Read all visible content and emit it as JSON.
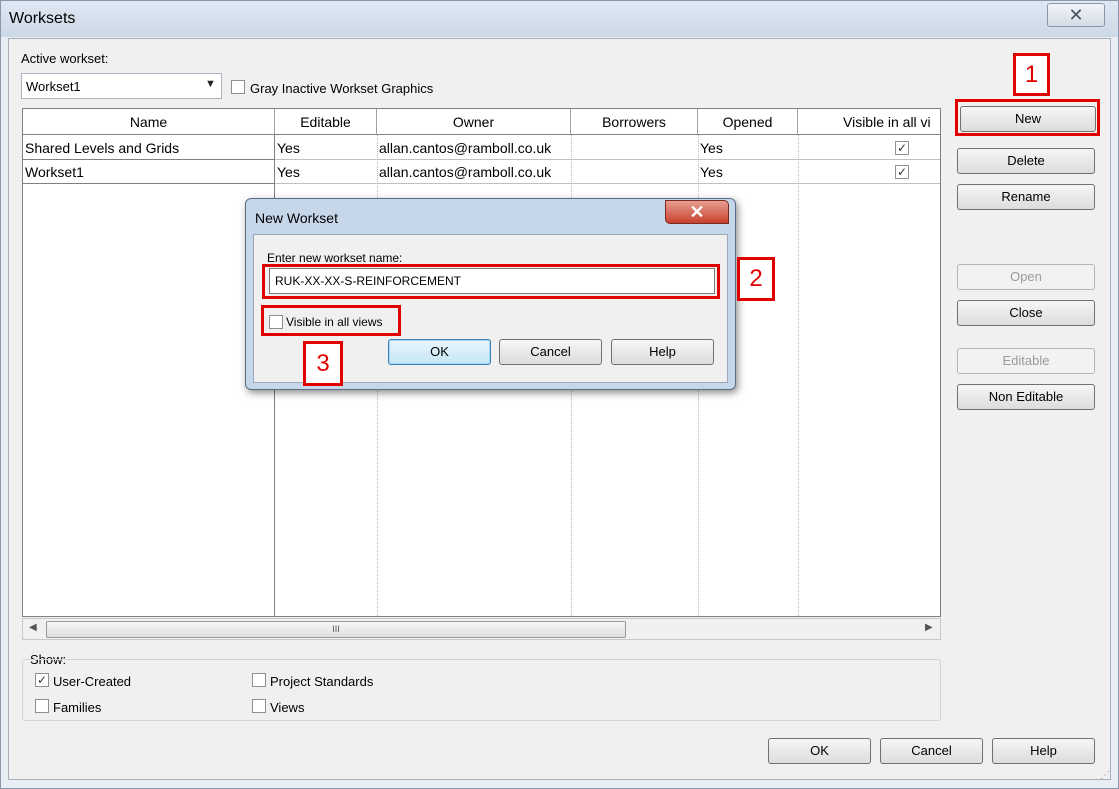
{
  "window": {
    "title": "Worksets",
    "close_glyph": "✕"
  },
  "active_workset": {
    "label": "Active workset:",
    "value": "Workset1"
  },
  "gray_inactive": {
    "label": "Gray Inactive Workset Graphics",
    "checked": false
  },
  "table": {
    "columns": [
      "Name",
      "Editable",
      "Owner",
      "Borrowers",
      "Opened",
      "Visible in all vi"
    ],
    "rows": [
      {
        "name": "Shared Levels and Grids",
        "editable": "Yes",
        "owner": "allan.cantos@ramboll.co.uk",
        "borrowers": "",
        "opened": "Yes",
        "visible": true
      },
      {
        "name": "Workset1",
        "editable": "Yes",
        "owner": "allan.cantos@ramboll.co.uk",
        "borrowers": "",
        "opened": "Yes",
        "visible": true
      }
    ],
    "scroll_grip": "III"
  },
  "side_buttons": {
    "new": "New",
    "delete": "Delete",
    "rename": "Rename",
    "open": "Open",
    "close": "Close",
    "editable": "Editable",
    "non_editable": "Non Editable"
  },
  "show": {
    "label": "Show:",
    "user_created": {
      "label": "User-Created",
      "checked": true
    },
    "families": {
      "label": "Families",
      "checked": false
    },
    "project_standards": {
      "label": "Project Standards",
      "checked": false
    },
    "views": {
      "label": "Views",
      "checked": false
    }
  },
  "bottom_buttons": {
    "ok": "OK",
    "cancel": "Cancel",
    "help": "Help"
  },
  "new_workset_dialog": {
    "title": "New Workset",
    "close_glyph": "✕",
    "prompt": "Enter new workset name:",
    "name_value": "RUK-XX-XX-S-REINFORCEMENT",
    "visible_label": "Visible in all views",
    "visible_checked": false,
    "ok": "OK",
    "cancel": "Cancel",
    "help": "Help"
  },
  "annotations": {
    "step1": "1",
    "step2": "2",
    "step3": "3",
    "accent_color": "#e00000"
  }
}
